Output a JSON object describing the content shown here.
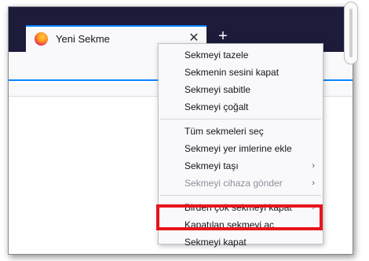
{
  "browser": {
    "tab": {
      "title": "Yeni Sekme",
      "close_glyph": "✕"
    },
    "newtab_glyph": "+",
    "colors": {
      "tabstrip": "#1c1b3a",
      "accent": "#0a84ff",
      "highlight": "#e8141b"
    }
  },
  "context_menu": {
    "items": [
      {
        "label": "Sekmeyi tazele"
      },
      {
        "label": "Sekmenin sesini kapat"
      },
      {
        "label": "Sekmeyi sabitle"
      },
      {
        "label": "Sekmeyi çoğalt"
      },
      {
        "label": "Tüm sekmeleri seç"
      },
      {
        "label": "Sekmeyi yer imlerine ekle"
      },
      {
        "label": "Sekmeyi taşı",
        "submenu_glyph": "›"
      },
      {
        "label": "Sekmeyi cihaza gönder",
        "submenu_glyph": "›"
      },
      {
        "label": "Birden çok sekmeyi kapat",
        "submenu_glyph": "›"
      },
      {
        "label": "Kapatılan sekmeyi aç"
      },
      {
        "label": "Sekmeyi kapat"
      }
    ]
  }
}
